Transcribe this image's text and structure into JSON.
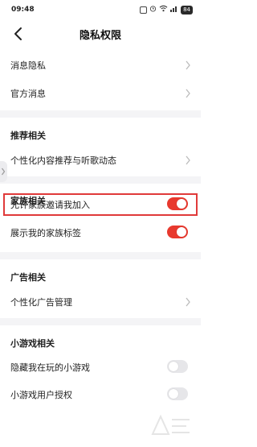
{
  "status_bar": {
    "time": "09:48",
    "battery": "84"
  },
  "header": {
    "title": "隐私权限"
  },
  "rows": {
    "message_privacy": "消息隐私",
    "official_messages": "官方消息",
    "recommend_section": "推荐相关",
    "personalized_content": "个性化内容推荐与听歌动态",
    "family_section": "家族相关",
    "allow_family_invite": "允许家族邀请我加入",
    "show_family_tag": "展示我的家族标签",
    "ads_section": "广告相关",
    "personalized_ads": "个性化广告管理",
    "minigame_section": "小游戏相关",
    "hide_minigames": "隐藏我在玩的小游戏",
    "minigame_auth": "小游戏用户授权"
  },
  "toggles": {
    "allow_family_invite": true,
    "show_family_tag": true,
    "hide_minigames": false,
    "minigame_auth": false
  },
  "colors": {
    "toggle_on": "#e8392e",
    "toggle_off": "#e6e6e9",
    "highlight_border": "#e03a3a",
    "section_gap": "#f4f4f6"
  }
}
